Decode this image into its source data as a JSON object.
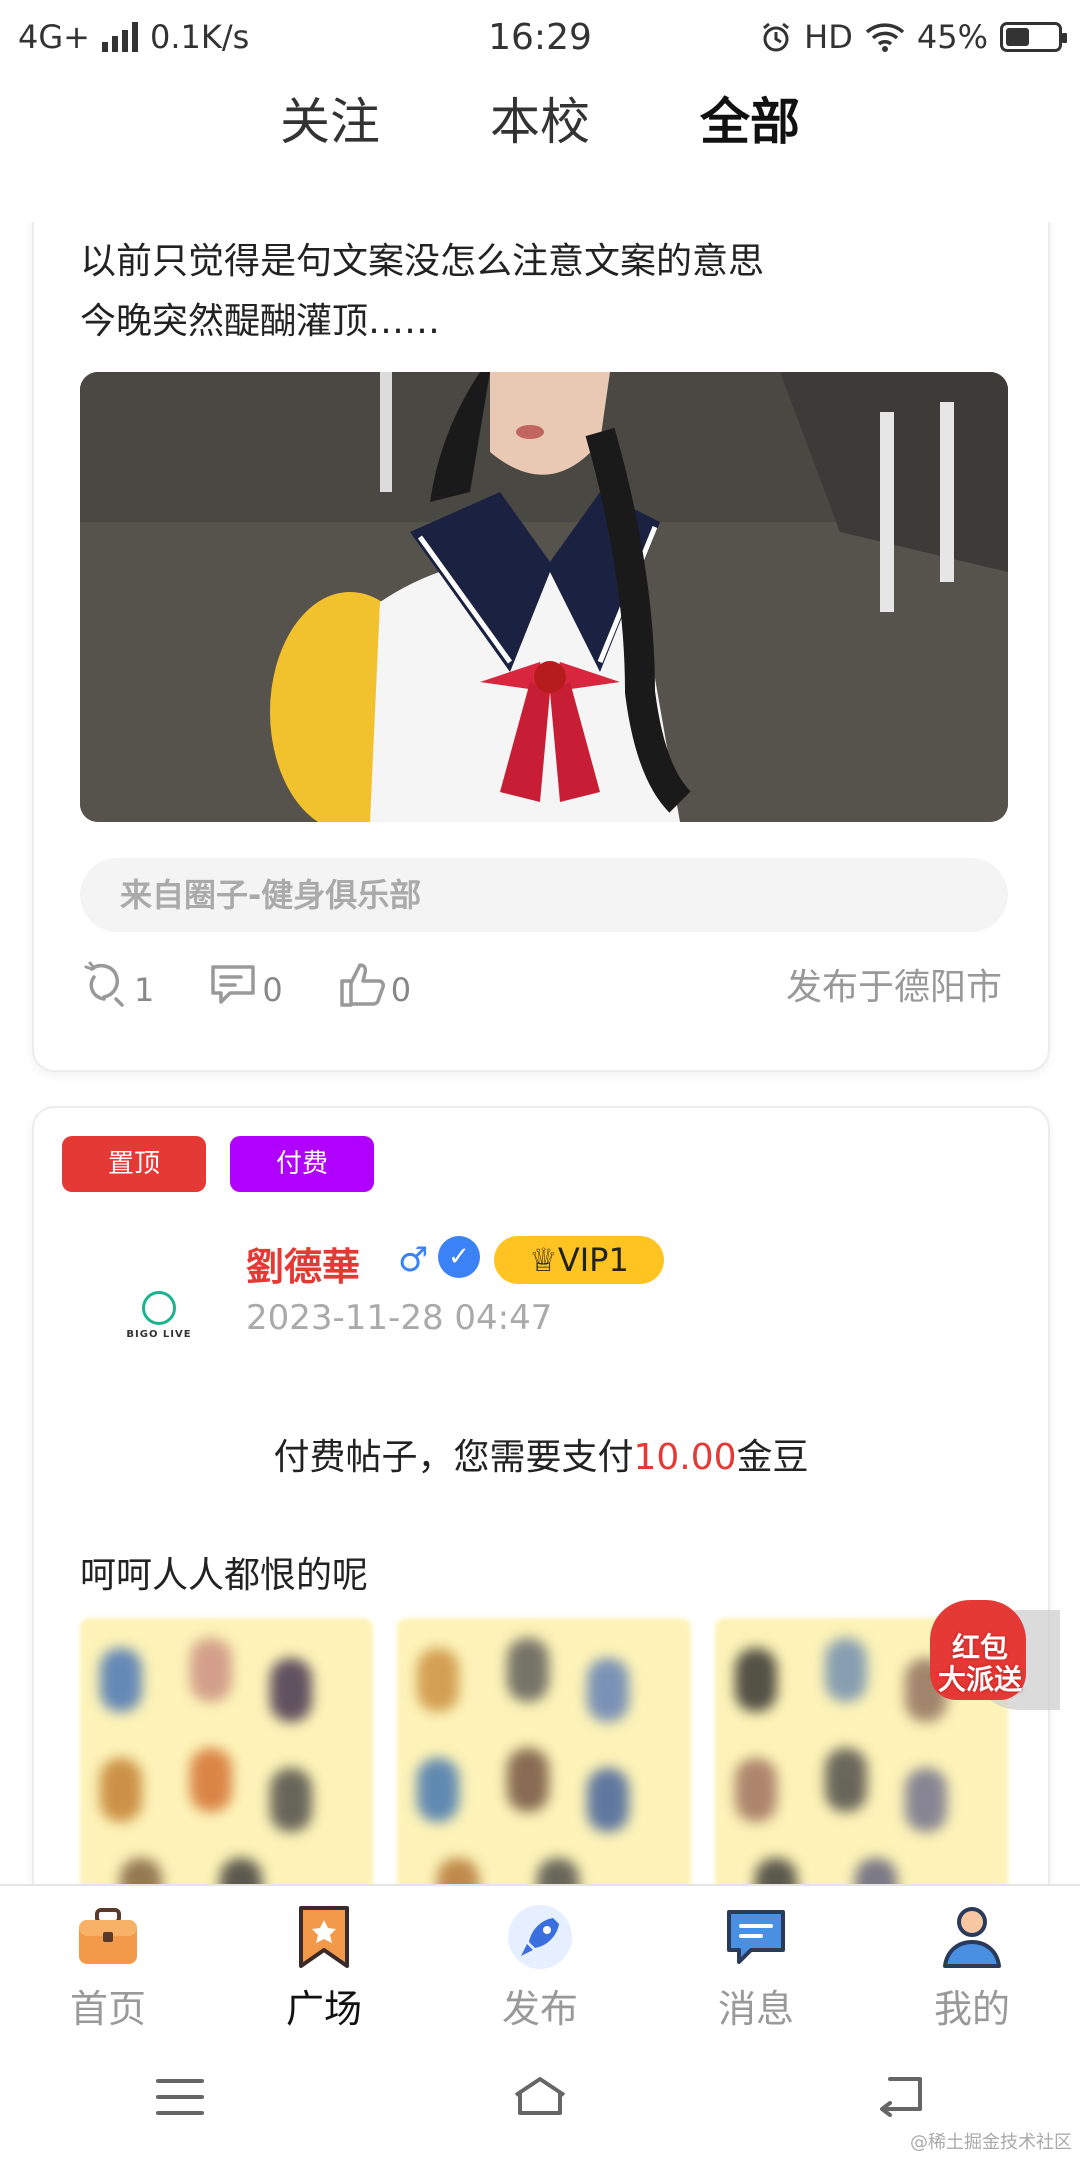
{
  "status_bar": {
    "network": "4G+",
    "speed": "0.1K/s",
    "time": "16:29",
    "hd": "HD",
    "battery": "45%",
    "battery_level": 0.45
  },
  "top_tabs": [
    {
      "label": "关注",
      "active": false
    },
    {
      "label": "本校",
      "active": false
    },
    {
      "label": "全部",
      "active": true
    }
  ],
  "post1": {
    "text_line1": "以前只觉得是句文案没怎么注意文案的意思",
    "text_line2": "今晚突然醍醐灌顶……",
    "circle": "来自圈子-健身俱乐部",
    "views": "1",
    "comments": "0",
    "likes": "0",
    "location": "发布于德阳市"
  },
  "post2": {
    "badge_top": "置顶",
    "badge_paid": "付费",
    "avatar_brand": "BIGO LIVE",
    "username": "劉德華",
    "gender_symbol": "♂",
    "verified_symbol": "✓",
    "vip": "VIP1",
    "vip_icon": "♕",
    "date": "2023-11-28 04:47",
    "paywall_prefix": "付费帖子，您需要支付",
    "paywall_amount": "10.00",
    "paywall_suffix": "金豆",
    "body": "呵呵人人都恨的呢"
  },
  "floating": {
    "line1": "红包",
    "line2": "大派送"
  },
  "bottom_nav": [
    {
      "label": "首页",
      "icon": "briefcase-icon",
      "active": false
    },
    {
      "label": "广场",
      "icon": "bookmark-star-icon",
      "active": true
    },
    {
      "label": "发布",
      "icon": "rocket-icon",
      "active": false
    },
    {
      "label": "消息",
      "icon": "message-icon",
      "active": false
    },
    {
      "label": "我的",
      "icon": "user-icon",
      "active": false
    }
  ],
  "watermark": "@稀土掘金技术社区",
  "colors": {
    "accent_red": "#e53935",
    "paid_purple": "#b000ff",
    "vip_gold": "#ffc421",
    "verified_blue": "#3b82f6"
  }
}
